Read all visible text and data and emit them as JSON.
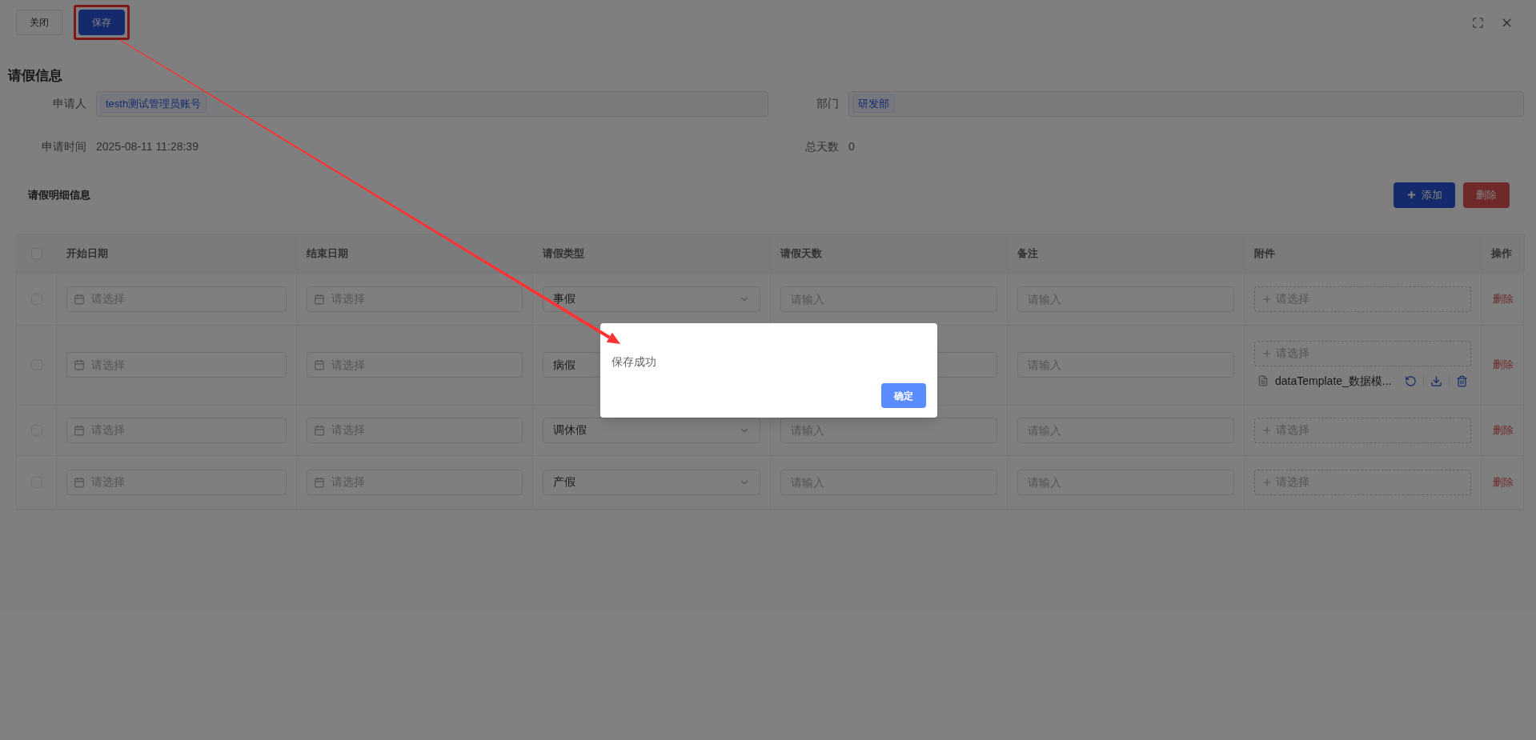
{
  "toolbar": {
    "buttons": [
      {
        "label": "关闭",
        "kind": "default",
        "highlighted": false
      },
      {
        "label": "保存",
        "kind": "primary",
        "highlighted": true
      }
    ]
  },
  "section_title": "请假信息",
  "form": {
    "applicant": {
      "label": "申请人",
      "tag": "testh测试管理员账号"
    },
    "department": {
      "label": "部门",
      "tag": "研发部"
    },
    "apply_time": {
      "label": "申请时间",
      "value": "2025-08-11 11:28:39"
    },
    "total_days": {
      "label": "总天数",
      "value": "0"
    }
  },
  "detail": {
    "title": "请假明细信息",
    "add_button": "添加",
    "delete_button": "删除"
  },
  "table": {
    "header_checked": false,
    "columns": [
      "开始日期",
      "结束日期",
      "请假类型",
      "请假天数",
      "备注",
      "附件",
      "操作"
    ],
    "rows": [
      {
        "checked": false,
        "start_date": {
          "placeholder": "请选择"
        },
        "end_date": {
          "placeholder": "请选择"
        },
        "leave_type": "事假",
        "days": {
          "placeholder": "请输入"
        },
        "remark": {
          "placeholder": "请输入"
        },
        "attachment": {
          "placeholder": "请选择"
        },
        "action": "删除"
      },
      {
        "checked": false,
        "start_date": {
          "placeholder": "请选择"
        },
        "end_date": {
          "placeholder": "请选择"
        },
        "leave_type": "病假",
        "remark": {
          "placeholder": "请输入"
        },
        "attachment": {
          "placeholder": "请选择",
          "files": [
            "dataTemplate_数据模..."
          ]
        },
        "action": "删除"
      },
      {
        "checked": false,
        "start_date": {
          "placeholder": "请选择"
        },
        "end_date": {
          "placeholder": "请选择"
        },
        "leave_type": "调休假",
        "days": {
          "placeholder": "请输入"
        },
        "remark": {
          "placeholder": "请输入"
        },
        "attachment": {
          "placeholder": "请选择"
        },
        "action": "删除"
      },
      {
        "checked": false,
        "start_date": {
          "placeholder": "请选择"
        },
        "end_date": {
          "placeholder": "请选择"
        },
        "leave_type": "产假",
        "days": {
          "placeholder": "请输入"
        },
        "remark": {
          "placeholder": "请输入"
        },
        "attachment": {
          "placeholder": "请选择"
        },
        "action": "删除"
      }
    ]
  },
  "dialog": {
    "message": "保存成功",
    "confirm": "确定"
  }
}
